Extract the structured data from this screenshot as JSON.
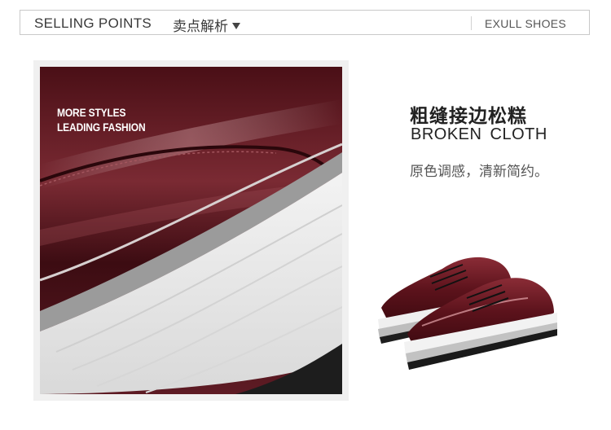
{
  "header": {
    "title": "SELLING POINTS",
    "subtitle": "卖点解析",
    "brand": "EXULL SHOES"
  },
  "photo": {
    "caption_line1": "MORE STYLES",
    "caption_line2": "LEADING FASHION"
  },
  "feature": {
    "heading_cn": "粗缝接边松糕",
    "heading_en": "BROKEN  CLOTH",
    "description": "原色调感，清新简约。"
  },
  "colors": {
    "leather": "#5a1a22",
    "sole": "#e9e9e9",
    "accent_text": "#222222"
  }
}
